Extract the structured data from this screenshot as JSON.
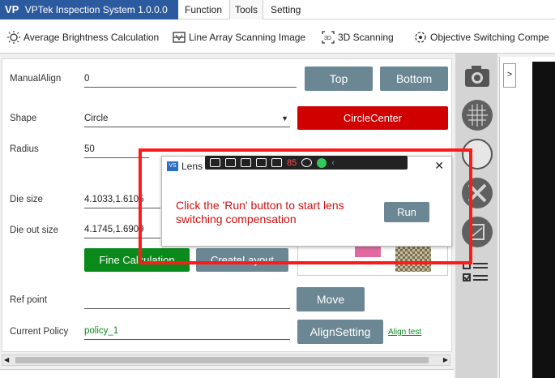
{
  "app": {
    "title": "VPTek Inspection System 1.0.0.0",
    "logo": "VP"
  },
  "menu": [
    "Function",
    "Tools",
    "Setting"
  ],
  "toolbar": [
    {
      "label": "Average Brightness Calculation",
      "icon": "sun-icon"
    },
    {
      "label": "Line Array Scanning Image",
      "icon": "line-scan-icon"
    },
    {
      "label": "3D Scanning",
      "icon": "3d-scan-icon"
    },
    {
      "label": "Objective Switching Compe",
      "icon": "objective-switch-icon"
    }
  ],
  "form": {
    "manual_align": {
      "label": "ManualAlign",
      "value": "0"
    },
    "shape": {
      "label": "Shape",
      "value": "Circle"
    },
    "radius": {
      "label": "Radius",
      "value": "50"
    },
    "die_size": {
      "label": "Die size",
      "value": "4.1033,1.6105"
    },
    "die_out_size": {
      "label": "Die out size",
      "value": "4.1745,1.6909"
    },
    "ref_point": {
      "label": "Ref point",
      "value": ""
    },
    "current_policy": {
      "label": "Current Policy",
      "value": "policy_1"
    }
  },
  "buttons": {
    "top": "Top",
    "bottom": "Bottom",
    "circle_center": "CircleCenter",
    "fine_calculation": "Fine Calculation",
    "create_layout": "CreateLayout",
    "move": "Move",
    "align_setting": "AlignSetting",
    "align_test": "Align test"
  },
  "dialog": {
    "title": "Lens",
    "message_line1": "Click the 'Run' button to start lens",
    "message_line2": "switching compensation",
    "run": "Run",
    "close": "✕",
    "floatbar_value": "85"
  },
  "viewer": {
    "expand": ">"
  },
  "colors": {
    "accent_red": "#d10000",
    "accent_green": "#0b8a1c",
    "button_gray": "#6b8794",
    "highlight_red": "#ff1a1a"
  }
}
